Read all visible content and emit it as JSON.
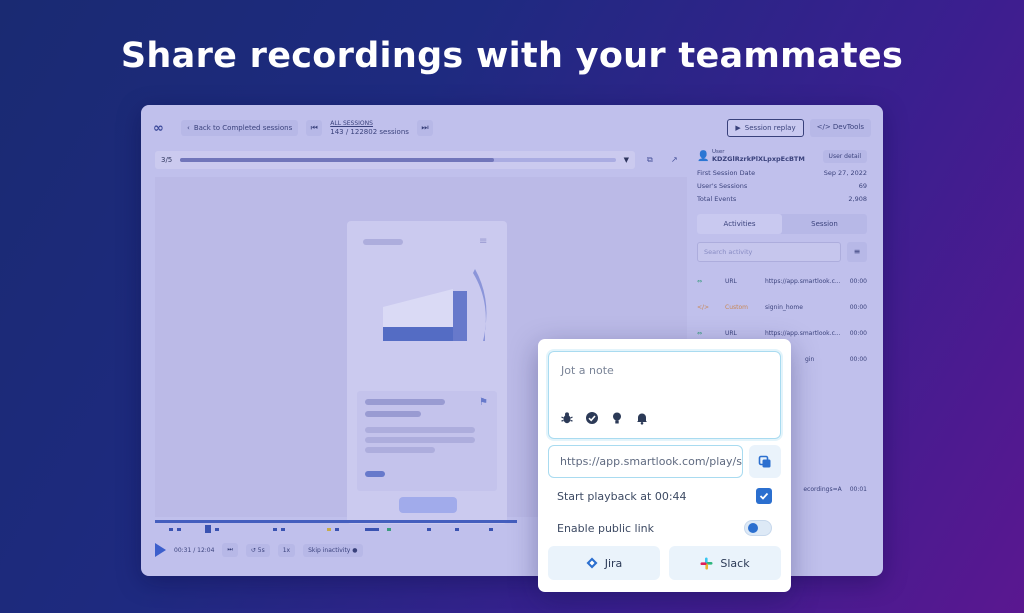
{
  "headline": "Share recordings with your teammates",
  "app": {
    "back_label": "Back to Completed sessions",
    "sessions_label": "ALL SESSIONS",
    "sessions_count": "143 / 122802 sessions",
    "session_replay_label": "Session replay",
    "devtools_label": "</> DevTools",
    "progress_label": "3/5",
    "progress_fraction": 0.72,
    "time_label": "00:31 / 12:04",
    "speed_step": "5s",
    "speed": "1x",
    "skip_label": "Skip inactivity",
    "side": {
      "user_caption": "User",
      "user_id": "KDZGlRzrkPlXLpxpEcBTM",
      "user_detail": "User detail",
      "stats": [
        {
          "label": "First Session Date",
          "value": "Sep 27, 2022"
        },
        {
          "label": "User's Sessions",
          "value": "69"
        },
        {
          "label": "Total Events",
          "value": "2,908"
        }
      ],
      "tab_activities": "Activities",
      "tab_session": "Session",
      "search_placeholder": "Search activity",
      "activities": [
        {
          "kind": "URL",
          "text": "https://app.smartlook.c...",
          "time": "00:00"
        },
        {
          "kind": "Custom",
          "text": "signin_home",
          "time": "00:00"
        },
        {
          "kind": "URL",
          "text": "https://app.smartlook.c...",
          "time": "00:00"
        },
        {
          "kind": "",
          "text": "gin",
          "time": "00:00"
        },
        {
          "kind": "",
          "text": "ecordings=A",
          "time": "00:01"
        }
      ]
    }
  },
  "share": {
    "note_placeholder": "Jot a note",
    "link_value": "https://app.smartlook.com/play/share",
    "start_playback_label": "Start playback at 00:44",
    "start_playback_checked": true,
    "public_link_label": "Enable public link",
    "public_link_enabled": false,
    "jira_label": "Jira",
    "slack_label": "Slack"
  }
}
